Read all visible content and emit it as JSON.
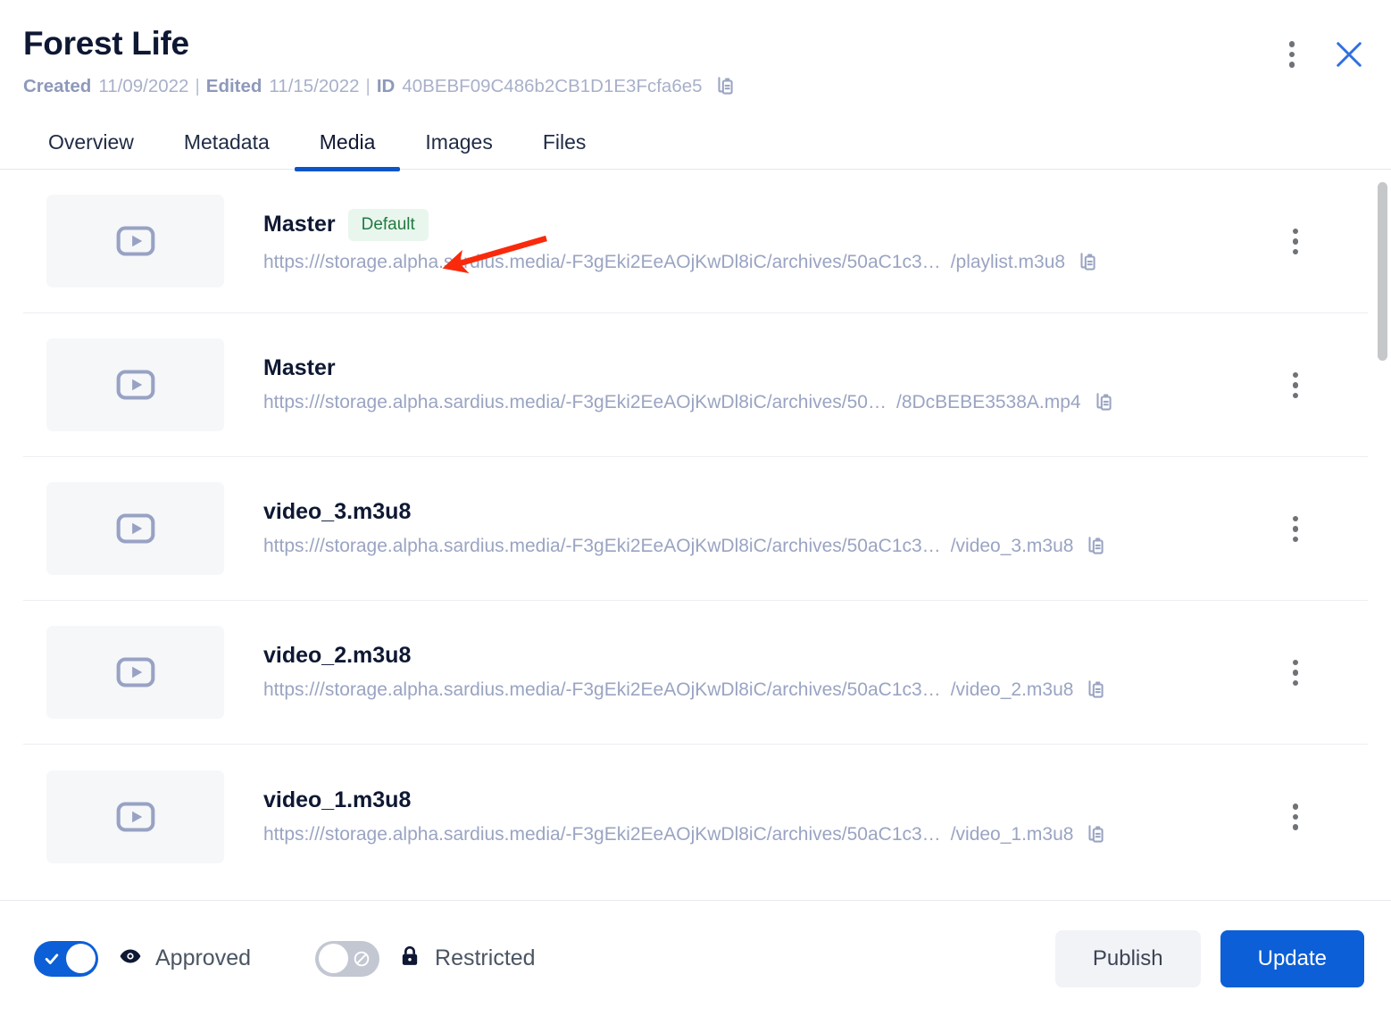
{
  "header": {
    "title": "Forest Life",
    "created_label": "Created",
    "created_value": "11/09/2022",
    "edited_label": "Edited",
    "edited_value": "11/15/2022",
    "id_label": "ID",
    "id_value": "40BEBF09C486b2CB1D1E3Fcfa6e5",
    "separator": "|",
    "copy_icon": "copy-icon",
    "kebab_icon": "kebab-menu-icon",
    "close_icon": "close-icon",
    "close_color": "#2f6fe0"
  },
  "tabs": [
    {
      "label": "Overview",
      "active": false
    },
    {
      "label": "Metadata",
      "active": false
    },
    {
      "label": "Media",
      "active": true
    },
    {
      "label": "Images",
      "active": false
    },
    {
      "label": "Files",
      "active": false
    }
  ],
  "media_rows": [
    {
      "title": "Master",
      "badge": "Default",
      "url_main": "https:///storage.alpha.sardius.media/-F3gEki2EeAOjKwDl8iC/archives/50aC1c3…",
      "url_suffix": "/playlist.m3u8",
      "thumb_icon": "video-play-icon",
      "copy_icon": "copy-icon",
      "kebab_icon": "kebab-menu-icon"
    },
    {
      "title": "Master",
      "badge": "",
      "url_main": "https:///storage.alpha.sardius.media/-F3gEki2EeAOjKwDl8iC/archives/50…",
      "url_suffix": "/8DcBEBE3538A.mp4",
      "thumb_icon": "video-play-icon",
      "copy_icon": "copy-icon",
      "kebab_icon": "kebab-menu-icon"
    },
    {
      "title": "video_3.m3u8",
      "badge": "",
      "url_main": "https:///storage.alpha.sardius.media/-F3gEki2EeAOjKwDl8iC/archives/50aC1c3…",
      "url_suffix": "/video_3.m3u8",
      "thumb_icon": "video-play-icon",
      "copy_icon": "copy-icon",
      "kebab_icon": "kebab-menu-icon"
    },
    {
      "title": "video_2.m3u8",
      "badge": "",
      "url_main": "https:///storage.alpha.sardius.media/-F3gEki2EeAOjKwDl8iC/archives/50aC1c3…",
      "url_suffix": "/video_2.m3u8",
      "thumb_icon": "video-play-icon",
      "copy_icon": "copy-icon",
      "kebab_icon": "kebab-menu-icon"
    },
    {
      "title": "video_1.m3u8",
      "badge": "",
      "url_main": "https:///storage.alpha.sardius.media/-F3gEki2EeAOjKwDl8iC/archives/50aC1c3…",
      "url_suffix": "/video_1.m3u8",
      "thumb_icon": "video-play-icon",
      "copy_icon": "copy-icon",
      "kebab_icon": "kebab-menu-icon"
    }
  ],
  "footer": {
    "approved_label": "Approved",
    "approved_state": "on",
    "approved_icon": "eye-icon",
    "restricted_label": "Restricted",
    "restricted_state": "off",
    "restricted_icon": "lock-icon",
    "publish_label": "Publish",
    "update_label": "Update",
    "primary_color": "#0c5fd6"
  },
  "annotation": {
    "type": "arrow",
    "color": "#f92a0c",
    "points": "from (612,267) to (497,300)"
  }
}
